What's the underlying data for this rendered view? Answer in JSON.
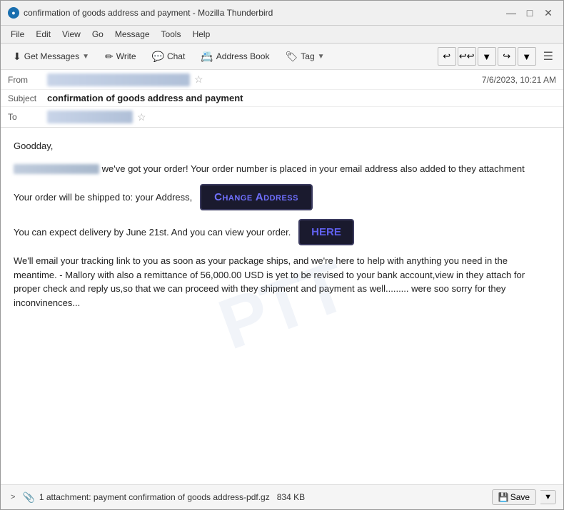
{
  "window": {
    "title": "confirmation of goods address and payment - Mozilla Thunderbird",
    "icon": "TB"
  },
  "titlebar": {
    "minimize": "—",
    "maximize": "□",
    "close": "✕"
  },
  "menubar": {
    "items": [
      "File",
      "Edit",
      "View",
      "Go",
      "Message",
      "Tools",
      "Help"
    ]
  },
  "toolbar": {
    "get_messages": "Get Messages",
    "write": "Write",
    "chat": "Chat",
    "address_book": "Address Book",
    "tag": "Tag",
    "hamburger": "☰"
  },
  "header": {
    "from_label": "From",
    "subject_label": "Subject",
    "to_label": "To",
    "subject_value": "confirmation of goods address and payment",
    "timestamp": "7/6/2023, 10:21 AM"
  },
  "email": {
    "greeting": "Goodday,",
    "paragraph1_suffix": " we've got your order! Your order number is placed in your email address also added to they attachment",
    "paragraph2_prefix": "Your order will be shipped to: your Address,",
    "change_address_btn": "Change Address",
    "paragraph3_prefix": "You can expect delivery by June 21st. And you can view your order.",
    "here_btn": "Here",
    "paragraph4": "We'll email your tracking link to you as soon as your package ships, and we're here to help with anything you need in the meantime. - Mallory with also a remittance of 56,000.00 USD is yet to be revised to your bank account,view in they attach for proper check and reply us,so that we  can proceed with they shipment and payment as well......... were soo sorry for they inconvinences..."
  },
  "attachment": {
    "expand_label": ">",
    "count_label": "1 attachment: payment confirmation of goods address-pdf.gz",
    "size": "834 KB",
    "save_btn": "Save"
  },
  "watermark": "PTT"
}
